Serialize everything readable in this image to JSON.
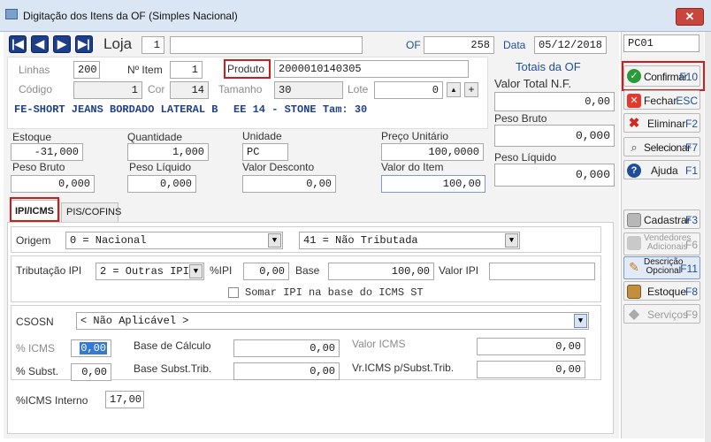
{
  "window": {
    "title": "Digitação dos Itens da OF (Simples Nacional)",
    "close_glyph": "✕"
  },
  "nav": {
    "first": "|◀",
    "prev": "◀",
    "next": "▶",
    "last": "▶|"
  },
  "header": {
    "loja_label": "Loja",
    "loja_value": "1",
    "loja_name": "",
    "of_label": "OF",
    "of_value": "258",
    "data_label": "Data",
    "data_value": "05/12/2018",
    "code_value": "PC01"
  },
  "item": {
    "linhas_label": "Linhas",
    "linhas_value": "200",
    "no_item_label": "Nº Item",
    "no_item_value": "1",
    "produto_label": "Produto",
    "produto_value": "2000010140305",
    "codigo_label": "Código",
    "codigo_value": "1",
    "cor_label": "Cor",
    "cor_value": "14",
    "tamanho_label": "Tamanho",
    "tamanho_value": "30",
    "lote_label": "Lote",
    "lote_value": "0",
    "description": "FE-SHORT JEANS BORDADO LATERAL B",
    "description_suffix": "EE 14 - STONE Tam: 30"
  },
  "totals": {
    "title": "Totais da OF",
    "valor_total_label": "Valor Total N.F.",
    "valor_total_value": "0,00",
    "peso_bruto_label": "Peso Bruto",
    "peso_bruto_value": "0,000",
    "peso_liquido_label": "Peso Líquido",
    "peso_liquido_value": "0,000"
  },
  "values": {
    "estoque_label": "Estoque",
    "estoque_value": "-31,000",
    "quantidade_label": "Quantidade",
    "quantidade_value": "1,000",
    "unidade_label": "Unidade",
    "unidade_value": "PC",
    "preco_label": "Preço Unitário",
    "preco_value": "100,0000",
    "peso_bruto_label": "Peso Bruto",
    "peso_bruto_value": "0,000",
    "peso_liquido_label": "Peso Líquido",
    "peso_liquido_value": "0,000",
    "desconto_label": "Valor Desconto",
    "desconto_value": "0,00",
    "valor_item_label": "Valor do Item",
    "valor_item_value": "100,00"
  },
  "tabs": [
    {
      "label": "IPI/ICMS"
    },
    {
      "label": "PIS/COFINS"
    }
  ],
  "ipi": {
    "origem_label": "Origem",
    "origem_value": "0 = Nacional",
    "trib_value": "41 = Não Tributada",
    "trib_ipi_label": "Tributação IPI",
    "trib_ipi_value": "2 = Outras IPI",
    "pct_ipi_label": "%IPI",
    "pct_ipi_value": "0,00",
    "base_label": "Base",
    "base_value": "100,00",
    "valor_ipi_label": "Valor IPI",
    "valor_ipi_value": "",
    "somar_label": "Somar IPI na base do ICMS ST"
  },
  "icms": {
    "csosn_label": "CSOSN",
    "csosn_value": "< Não Aplicável >",
    "pct_icms_label": "% ICMS",
    "pct_icms_value": "0,00",
    "base_calc_label": "Base de Cálculo",
    "base_calc_value": "0,00",
    "valor_icms_label": "Valor ICMS",
    "valor_icms_value": "0,00",
    "pct_subst_label": "% Subst.",
    "pct_subst_value": "0,00",
    "base_subst_label": "Base Subst.Trib.",
    "base_subst_value": "0,00",
    "vr_icms_subst_label": "Vr.ICMS p/Subst.Trib.",
    "vr_icms_subst_value": "0,00",
    "icms_interno_label": "%ICMS Interno",
    "icms_interno_value": "17,00"
  },
  "side": {
    "confirmar": {
      "label": "Confirmar",
      "key": "F10"
    },
    "fechar": {
      "label": "Fechar",
      "key": "ESC"
    },
    "eliminar": {
      "label": "Eliminar",
      "key": "F2"
    },
    "selecionar": {
      "label": "Selecionar",
      "key": "F7"
    },
    "ajuda": {
      "label": "Ajuda",
      "key": "F1"
    },
    "cadastrar": {
      "label": "Cadastrar",
      "key": "F3"
    },
    "vendedores": {
      "label1": "Vendedores",
      "label2": "Adicionais",
      "key": "F6"
    },
    "descricao": {
      "label1": "Descrição",
      "label2": "Opcional",
      "key": "F11"
    },
    "estoque": {
      "label": "Estoque",
      "key": "F8"
    },
    "servicos": {
      "label": "Serviços",
      "key": "F9"
    }
  },
  "colors": {
    "accent_blue": "#1d3f8a",
    "highlight_red": "#d11a1a",
    "confirm_green": "#2a9a3a"
  }
}
